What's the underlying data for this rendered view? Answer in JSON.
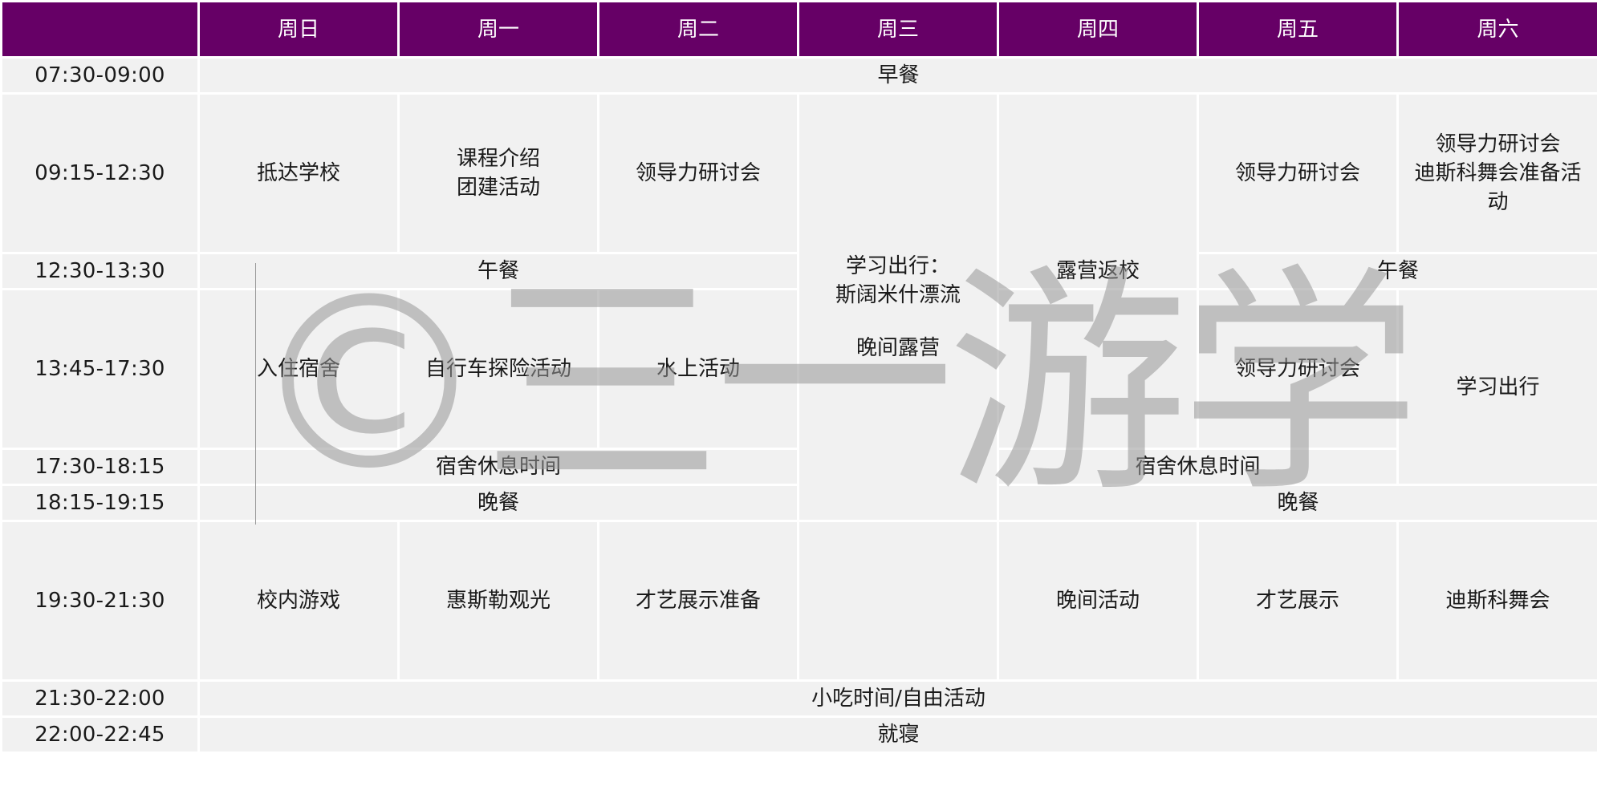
{
  "header": {
    "days": [
      "周日",
      "周一",
      "周二",
      "周三",
      "周四",
      "周五",
      "周六"
    ]
  },
  "times": [
    "07:30-09:00",
    "09:15-12:30",
    "12:30-13:30",
    "13:45-17:30",
    "17:30-18:15",
    "18:15-19:15",
    "19:30-21:30",
    "21:30-22:00",
    "22:00-22:45"
  ],
  "cells": {
    "breakfast": "早餐",
    "sun_morning": "抵达学校",
    "mon_morning_1": "课程介绍",
    "mon_morning_2": "团建活动",
    "tue_morning": "领导力研讨会",
    "wed_trip_1": "学习出行：",
    "wed_trip_2": "斯阔米什漂流",
    "wed_trip_3": "晚间露营",
    "thu_return": "露营返校",
    "fri_morning": "领导力研讨会",
    "sat_morning_1": "领导力研讨会",
    "sat_morning_2": "迪斯科舞会准备活",
    "sat_morning_3": "动",
    "lunch_left": "午餐",
    "lunch_right": "午餐",
    "sun_afternoon": "入住宿舍",
    "mon_afternoon": "自行车探险活动",
    "tue_afternoon": "水上活动",
    "fri_afternoon": "领导力研讨会",
    "sat_afternoon": "学习出行",
    "rest_left": "宿舍休息时间",
    "rest_right": "宿舍休息时间",
    "dinner_left": "晚餐",
    "dinner_right": "晚餐",
    "sun_evening": "校内游戏",
    "mon_evening": "惠斯勒观光",
    "tue_evening": "才艺展示准备",
    "thu_evening": "晚间活动",
    "fri_evening": "才艺展示",
    "sat_evening": "迪斯科舞会",
    "snack": "小吃时间/自由活动",
    "sleep": "就寝"
  },
  "watermark": "©三一游学",
  "colors": {
    "header_bg": "#660066",
    "cell_bg": "#f1f1f1",
    "border": "#ffffff"
  }
}
